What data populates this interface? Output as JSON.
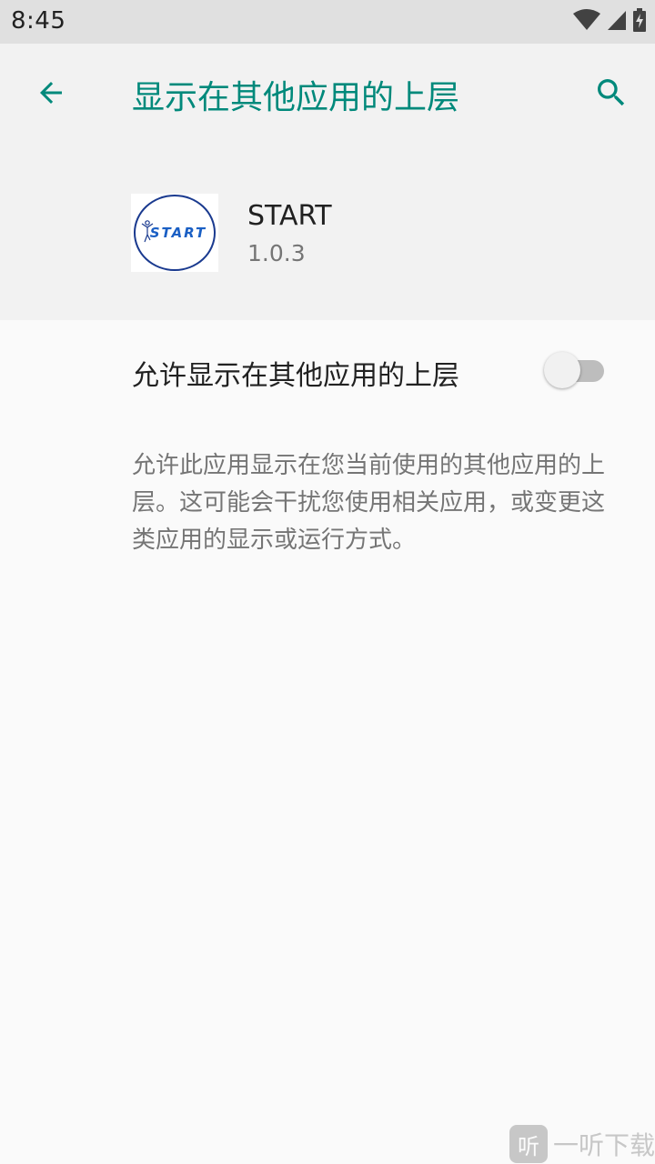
{
  "status_bar": {
    "time": "8:45",
    "icons": [
      "wifi-icon",
      "cell-signal-icon",
      "battery-charging-icon"
    ]
  },
  "app_bar": {
    "title": "显示在其他应用的上层",
    "back_icon": "arrow-back-icon",
    "search_icon": "search-icon",
    "accent_color": "#00897b"
  },
  "app_header": {
    "name": "START",
    "version": "1.0.3",
    "logo_text": "START"
  },
  "setting": {
    "label": "允许显示在其他应用的上层",
    "enabled": false
  },
  "description": "允许此应用显示在您当前使用的其他应用的上层。这可能会干扰您使用相关应用，或变更这类应用的显示或运行方式。",
  "watermark": {
    "badge": "听",
    "text": "一听下载"
  }
}
